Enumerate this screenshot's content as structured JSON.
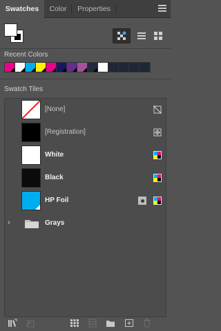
{
  "tabs": [
    {
      "label": "Swatches",
      "active": true
    },
    {
      "label": "Color",
      "active": false
    },
    {
      "label": "Properties",
      "active": false
    }
  ],
  "fill_color": "#ffffff",
  "stroke_color": "#000000",
  "view_buttons": [
    "show-swatch-kinds-icon",
    "list-view-icon",
    "grid-view-icon"
  ],
  "recent": {
    "label": "Recent Colors",
    "swatches": [
      "#ec008c",
      "#ffffff",
      "#00aeef",
      "#fff200",
      "#ec008c",
      "#1b1464",
      "#662d91",
      "#a8519b",
      "#232a3b",
      "#ffffff",
      "#1f2636",
      "#1f2636",
      "#1f2636",
      "#1f2636"
    ]
  },
  "tiles": {
    "label": "Swatch Tiles",
    "rows": [
      {
        "label": "[None]",
        "color": "#ffffff",
        "type": "none"
      },
      {
        "label": "[Registration]",
        "color": "#000000",
        "type": "registration"
      },
      {
        "label": "White",
        "color": "#ffffff",
        "type": "process"
      },
      {
        "label": "Black",
        "color": "#0b0b0b",
        "type": "process"
      },
      {
        "label": "HP Foil",
        "color": "#00aeef",
        "type": "spot"
      }
    ],
    "group": {
      "label": "Grays"
    }
  },
  "toolbar": [
    "swatch-libraries-menu-icon",
    "place-swatches-icon",
    "show-kinds-menu-icon",
    "swatch-options-icon",
    "new-color-group-icon",
    "new-swatch-icon",
    "delete-swatch-icon"
  ]
}
